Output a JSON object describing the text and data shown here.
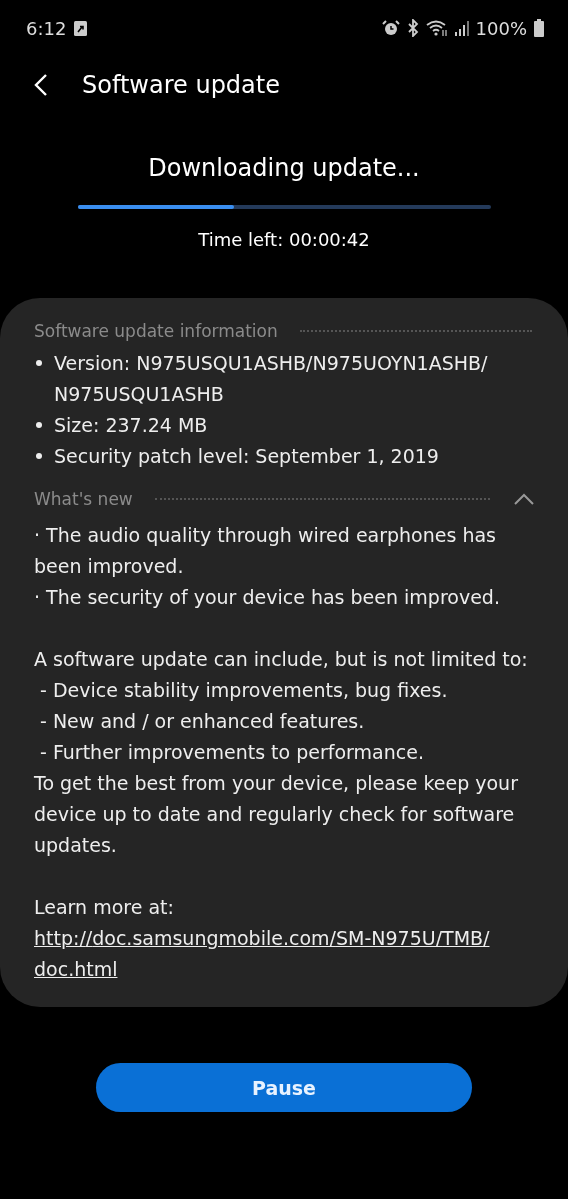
{
  "status_bar": {
    "time": "6:12",
    "battery": "100%"
  },
  "header": {
    "title": "Software update"
  },
  "download": {
    "title": "Downloading update...",
    "level": 0.38,
    "time_left": "Time left: 00:00:42"
  },
  "info": {
    "heading": "Software update information",
    "items": [
      "Version: N975USQU1ASHB/N975UOYN1ASHB/N975USQU1ASHB",
      "Size: 237.24 MB",
      "Security patch level: September 1, 2019"
    ]
  },
  "whats_new": {
    "heading": "What's new",
    "expanded": true,
    "paragraphs": [
      {
        "kind": "text",
        "text": "· The audio quality through wired earphones has been improved."
      },
      {
        "kind": "text",
        "text": "· The security of your device has been improved."
      },
      {
        "kind": "gap"
      },
      {
        "kind": "text",
        "text": "A software update can include, but is not limited to:"
      },
      {
        "kind": "sub",
        "text": "- Device stability improvements, bug fixes."
      },
      {
        "kind": "sub",
        "text": "- New and / or enhanced features."
      },
      {
        "kind": "sub",
        "text": "- Further improvements to performance."
      },
      {
        "kind": "text",
        "text": "To get the best from your device, please keep your device up to date and regularly check for software updates."
      },
      {
        "kind": "gap"
      },
      {
        "kind": "text",
        "text": "Learn more at:"
      },
      {
        "kind": "link",
        "text": "http://doc.samsungmobile.com/SM-N975U/TMB/doc.html"
      }
    ]
  },
  "button": {
    "label": "Pause"
  }
}
